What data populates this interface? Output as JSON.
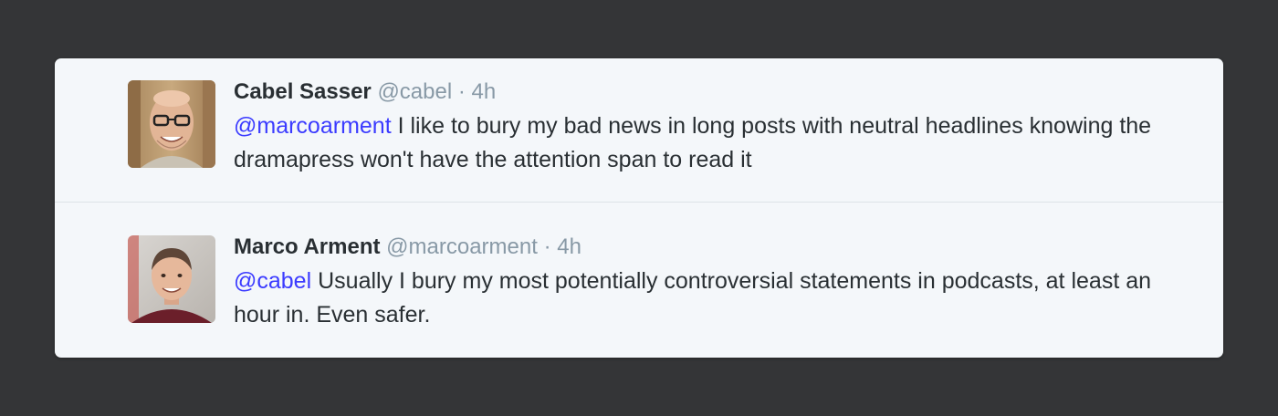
{
  "colors": {
    "page_background": "#343537",
    "card_background": "#f4f7fa",
    "name": "#292f33",
    "meta": "#8899a6",
    "mention": "#3b3bff"
  },
  "tweets": [
    {
      "avatar_icon": "avatar-cabel-sasser",
      "name": "Cabel Sasser",
      "handle": "@cabel",
      "separator": "·",
      "time": "4h",
      "mention": "@marcoarment",
      "text": "I like to bury my bad news in long posts with neutral headlines knowing the dramapress won't have the attention span to read it"
    },
    {
      "avatar_icon": "avatar-marco-arment",
      "name": "Marco Arment",
      "handle": "@marcoarment",
      "separator": "·",
      "time": "4h",
      "mention": "@cabel",
      "text": "Usually I bury my most potentially controversial statements in podcasts, at least an hour in. Even safer."
    }
  ]
}
